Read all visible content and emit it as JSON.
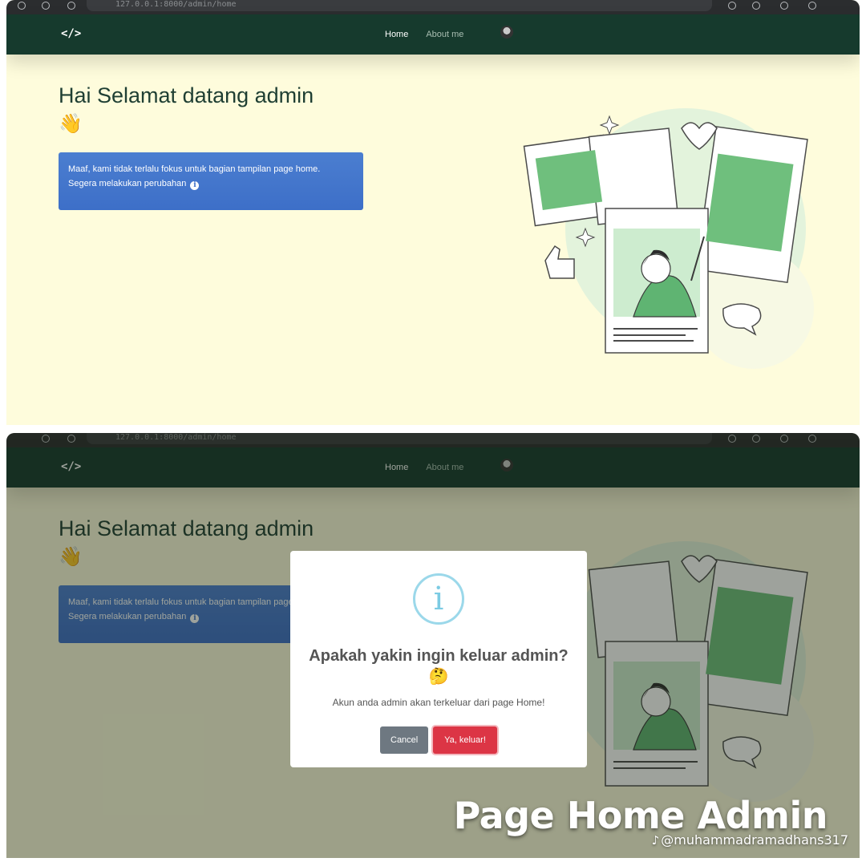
{
  "browser": {
    "url_text": "127.0.0.1:8000/admin/home"
  },
  "navbar": {
    "brand": "</>",
    "links": [
      "Home",
      "About me"
    ]
  },
  "home": {
    "greeting": "Hai Selamat datang admin",
    "wave_emoji": "👋",
    "alert_line1": "Maaf, kami tidak terlalu fokus untuk bagian tampilan page home.",
    "alert_line2": "Segera melakukan perubahan",
    "alert_icon": "info-icon"
  },
  "modal": {
    "icon_glyph": "i",
    "title": "Apakah yakin ingin keluar admin?",
    "title_emoji": "🤔",
    "text": "Akun anda admin akan terkeluar dari page Home!",
    "cancel_label": "Cancel",
    "confirm_label": "Ya, keluar!"
  },
  "overlay_text": {
    "caption": "Page Home Admin",
    "handle": "@muhammadramadhans317"
  },
  "colors": {
    "navbar": "#163a2d",
    "page_background": "#fefcdc",
    "alert": "#3d6fc8",
    "confirm_button": "#dc3545",
    "cancel_button": "#6e7881",
    "modal_icon": "#9bd8ea",
    "illustration_green": "#6fbf7d"
  }
}
